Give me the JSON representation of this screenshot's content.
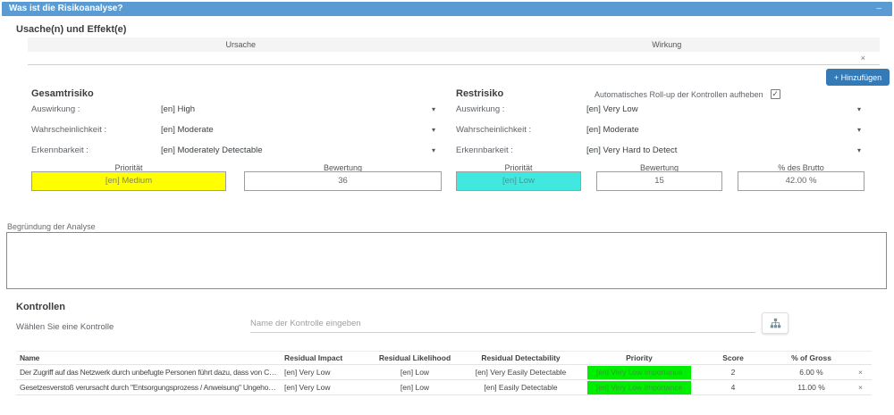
{
  "panel": {
    "title": "Was ist die Risikoanalyse?",
    "minimize_glyph": "–"
  },
  "icons": {
    "close": "×",
    "dropdown_caret": "▾",
    "checkbox_checked": "✓",
    "hierarchy_icon": "tree-structure"
  },
  "colors": {
    "titlebar_blue": "#5b9bd3",
    "button_blue": "#337ab7",
    "priority_medium_yellow": "#ffff00",
    "priority_low_cyan": "#40e8df",
    "priority_very_low_green": "#00ee00"
  },
  "cause_effect": {
    "heading": "Usache(n) und Effekt(e)",
    "columns": [
      "Ursache",
      "Wirkung"
    ],
    "add_button_label": "+ Hinzufügen"
  },
  "gross_risk": {
    "heading": "Gesamtrisiko",
    "fields": [
      {
        "label": "Auswirkung :",
        "value": "[en] High"
      },
      {
        "label": "Wahrscheinlichkeit :",
        "value": "[en] Moderate"
      },
      {
        "label": "Erkennbarkeit :",
        "value": "[en] Moderately Detectable"
      }
    ],
    "priority": {
      "label": "Priorität",
      "value": "[en] Medium",
      "color": "#ffff00"
    },
    "score": {
      "label": "Bewertung",
      "value": "36"
    }
  },
  "residual_risk": {
    "heading": "Restrisiko",
    "rollup_label": "Automatisches Roll-up der Kontrollen aufheben",
    "rollup_checked": true,
    "fields": [
      {
        "label": "Auswirkung :",
        "value": "[en] Very Low"
      },
      {
        "label": "Wahrscheinlichkeit :",
        "value": "[en] Moderate"
      },
      {
        "label": "Erkennbarkeit :",
        "value": "[en] Very Hard to Detect"
      }
    ],
    "priority": {
      "label": "Priorität",
      "value": "[en] Low",
      "color": "#40e8df"
    },
    "score": {
      "label": "Bewertung",
      "value": "15"
    },
    "gross_pct": {
      "label": "% des Brutto",
      "value": "42.00 %"
    }
  },
  "justification": {
    "label": "Begründung der Analyse",
    "value": ""
  },
  "controls": {
    "heading": "Kontrollen",
    "select_label": "Wählen Sie eine Kontrolle",
    "input_placeholder": "Name der Kontrolle eingeben",
    "table": {
      "columns": [
        "Name",
        "Residual Impact",
        "Residual Likelihood",
        "Residual Detectability",
        "Priority",
        "Score",
        "% of Gross"
      ],
      "rows": [
        {
          "name": "Der Zugriff auf das Netzwerk durch unbefugte Personen führt dazu, dass von Clients sch...",
          "impact": "[en] Very Low",
          "likelihood": "[en] Low",
          "detectability": "[en] Very Easily Detectable",
          "priority": "[en] Very Low Importance",
          "priority_color": "#00ee00",
          "score": "2",
          "gross": "6.00 %"
        },
        {
          "name": "Gesetzesverstoß verursacht durch \"Entsorgungsprozess / Anweisung\" Ungehorsam",
          "impact": "[en] Very Low",
          "likelihood": "[en] Low",
          "detectability": "[en] Easily Detectable",
          "priority": "[en] Very Low Importance",
          "priority_color": "#00ee00",
          "score": "4",
          "gross": "11.00 %"
        }
      ]
    }
  }
}
